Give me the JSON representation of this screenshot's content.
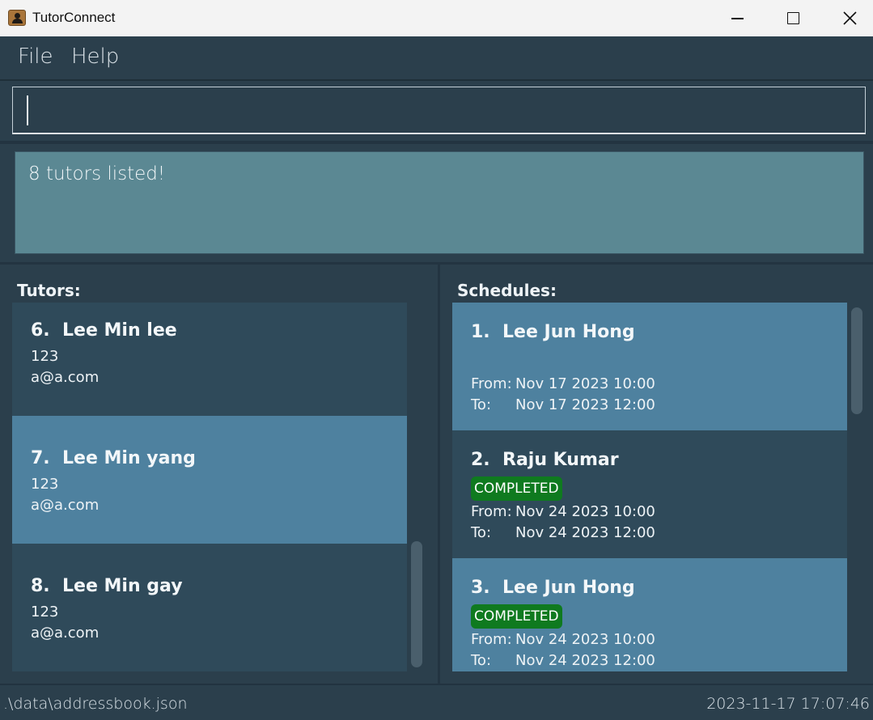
{
  "window": {
    "title": "TutorConnect",
    "app_icon": "contact-book-icon",
    "controls": [
      "minimize-icon",
      "maximize-icon",
      "close-icon"
    ]
  },
  "menu": {
    "file": "File",
    "help": "Help"
  },
  "command": {
    "value": "",
    "placeholder": ""
  },
  "result": {
    "message": "8 tutors listed!"
  },
  "tutors": {
    "heading": "Tutors:",
    "items": [
      {
        "index": "6.",
        "name": "Lee Min lee",
        "phone": "123",
        "email": "a@a.com"
      },
      {
        "index": "7.",
        "name": "Lee Min yang",
        "phone": "123",
        "email": "a@a.com"
      },
      {
        "index": "8.",
        "name": "Lee Min gay",
        "phone": "123",
        "email": "a@a.com"
      }
    ]
  },
  "schedules": {
    "heading": "Schedules:",
    "from_label": "From:",
    "to_label": "To:",
    "items": [
      {
        "index": "1.",
        "name": "Lee Jun Hong",
        "status": "",
        "from": "Nov 17 2023 10:00",
        "to": "Nov 17 2023 12:00"
      },
      {
        "index": "2.",
        "name": "Raju Kumar",
        "status": "COMPLETED",
        "from": "Nov 24 2023 10:00",
        "to": "Nov 24 2023 12:00"
      },
      {
        "index": "3.",
        "name": "Lee Jun Hong",
        "status": "COMPLETED",
        "from": "Nov 24 2023 10:00",
        "to": "Nov 24 2023 12:00"
      }
    ]
  },
  "status": {
    "path": ".\\data\\addressbook.json",
    "timestamp": "2023-11-17 17:07:46"
  },
  "colors": {
    "background": "#2b3f4c",
    "card_dark": "#2f4a5a",
    "card_selected": "#4e819f",
    "result_box": "#5b8893",
    "completed_badge": "#0f7a1f"
  }
}
